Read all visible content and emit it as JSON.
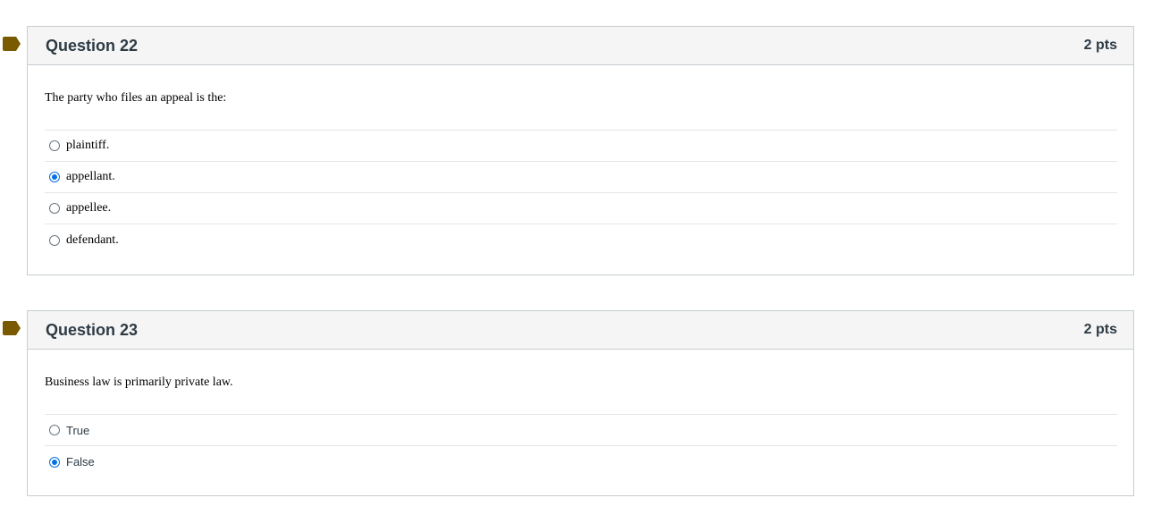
{
  "flag_color": "#7a5a00",
  "selected_color": "#0770e3",
  "questions": [
    {
      "title": "Question 22",
      "points": "2 pts",
      "text": "The party who files an appeal is the:",
      "answers": [
        {
          "label": "plaintiff.",
          "selected": false
        },
        {
          "label": "appellant.",
          "selected": true
        },
        {
          "label": "appellee.",
          "selected": false
        },
        {
          "label": "defendant.",
          "selected": false
        }
      ]
    },
    {
      "title": "Question 23",
      "points": "2 pts",
      "text": "Business law is primarily private law.",
      "answers": [
        {
          "label": "True",
          "selected": false
        },
        {
          "label": "False",
          "selected": true
        }
      ]
    }
  ]
}
